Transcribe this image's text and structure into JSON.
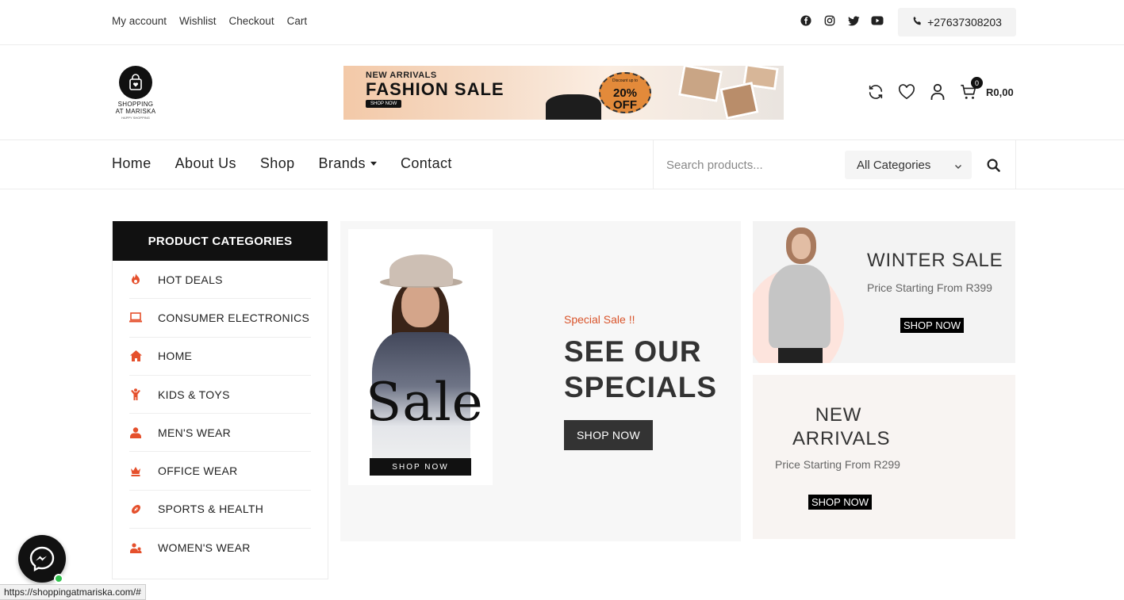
{
  "topbar": {
    "links": [
      "My account",
      "Wishlist",
      "Checkout",
      "Cart"
    ],
    "socials": [
      "facebook-icon",
      "instagram-icon",
      "twitter-icon",
      "youtube-icon"
    ],
    "phone": "+27637308203"
  },
  "logo": {
    "line1": "SHOPPING",
    "line2": "AT MARISKA",
    "tagline": "HAPPY SHOPPING"
  },
  "banner": {
    "eyebrow": "NEW ARRIVALS",
    "title": "FASHION SALE",
    "button": "SHOP NOW",
    "discount": "20%",
    "discount_word": "OFF",
    "discount_pre": "Discount up to"
  },
  "header_icons": {
    "cart_count": "0",
    "cart_total": "R0,00"
  },
  "nav": {
    "items": [
      "Home",
      "About Us",
      "Shop",
      "Brands",
      "Contact"
    ],
    "search_placeholder": "Search products...",
    "category_select": "All Categories"
  },
  "sidebar": {
    "title": "PRODUCT CATEGORIES",
    "items": [
      "HOT DEALS",
      "CONSUMER ELECTRONICS",
      "HOME",
      "KIDS & TOYS",
      "MEN'S WEAR",
      "OFFICE WEAR",
      "SPORTS & HEALTH",
      "WOMEN'S WEAR"
    ]
  },
  "hero": {
    "card_word": "Sale",
    "card_button": "SHOP NOW",
    "special": "Special Sale !!",
    "title": "SEE OUR SPECIALS",
    "button": "SHOP NOW"
  },
  "promo_winter": {
    "title": "WINTER SALE",
    "subtitle": "Price Starting From R399",
    "button": "SHOP NOW"
  },
  "promo_new": {
    "title": "NEW ARRIVALS",
    "subtitle": "Price Starting From R299",
    "button": "SHOP NOW"
  },
  "status_url": "https://shoppingatmariska.com/#",
  "colors": {
    "accent": "#d9542b",
    "dark": "#111111",
    "online": "#31c24d"
  }
}
